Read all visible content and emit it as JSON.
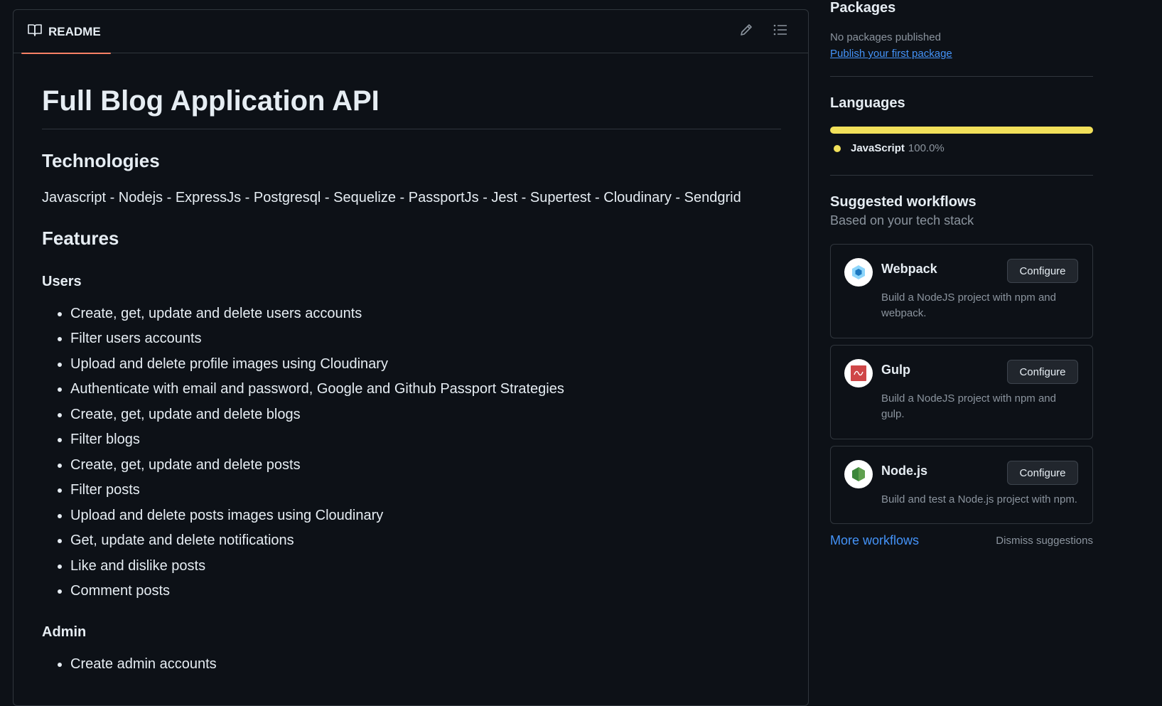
{
  "readme": {
    "tab_label": "README",
    "title": "Full Blog Application API",
    "technologies_heading": "Technologies",
    "technologies_text": "Javascript - Nodejs - ExpressJs - Postgresql - Sequelize - PassportJs - Jest - Supertest - Cloudinary - Sendgrid",
    "features_heading": "Features",
    "users_heading": "Users",
    "users_items": [
      "Create, get, update and delete users accounts",
      "Filter users accounts",
      "Upload and delete profile images using Cloudinary",
      "Authenticate with email and password, Google and Github Passport Strategies",
      "Create, get, update and delete blogs",
      "Filter blogs",
      "Create, get, update and delete posts",
      "Filter posts",
      "Upload and delete posts images using Cloudinary",
      "Get, update and delete notifications",
      "Like and dislike posts",
      "Comment posts"
    ],
    "admin_heading": "Admin",
    "admin_items": [
      "Create admin accounts"
    ]
  },
  "sidebar": {
    "packages": {
      "heading": "Packages",
      "empty_text": "No packages published",
      "publish_link": "Publish your first package"
    },
    "languages": {
      "heading": "Languages",
      "items": [
        {
          "name": "JavaScript",
          "percent": "100.0%",
          "color": "#f1e05a",
          "fraction": 1.0
        }
      ]
    },
    "workflows": {
      "heading": "Suggested workflows",
      "subheading": "Based on your tech stack",
      "cards": [
        {
          "name": "Webpack",
          "description": "Build a NodeJS project with npm and webpack.",
          "button": "Configure"
        },
        {
          "name": "Gulp",
          "description": "Build a NodeJS project with npm and gulp.",
          "button": "Configure"
        },
        {
          "name": "Node.js",
          "description": "Build and test a Node.js project with npm.",
          "button": "Configure"
        }
      ],
      "more_link": "More workflows",
      "dismiss": "Dismiss suggestions"
    }
  },
  "icons": {
    "readme_tab": "book-icon",
    "edit": "pencil-icon",
    "outline": "list-icon"
  },
  "colors": {
    "background": "#0d1117",
    "border": "#30363d",
    "tab_underline": "#f78166",
    "link": "#4493f8",
    "javascript": "#f1e05a"
  }
}
